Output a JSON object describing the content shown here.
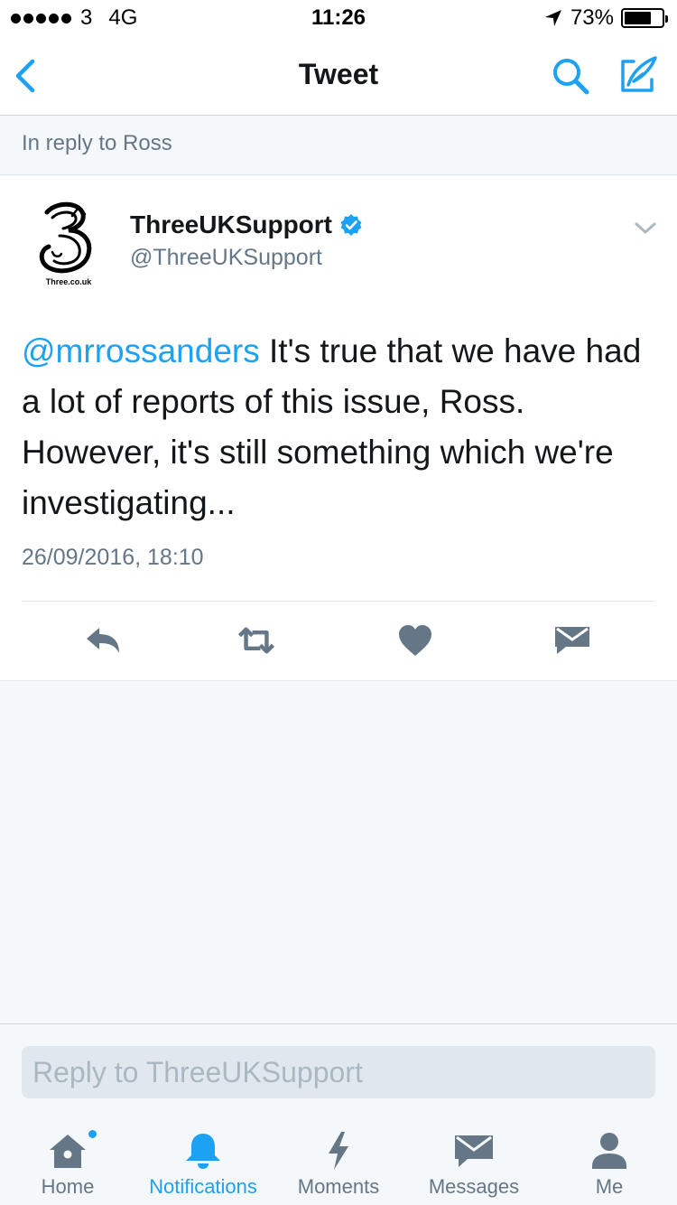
{
  "status_bar": {
    "carrier": "3",
    "network": "4G",
    "time": "11:26",
    "battery": "73%",
    "battery_level": 0.73
  },
  "nav": {
    "title": "Tweet"
  },
  "reply_context": "In reply to Ross",
  "tweet": {
    "avatar_text": "Three.co.uk",
    "author_name": "ThreeUKSupport",
    "author_handle": "@ThreeUKSupport",
    "mention": "@mrrossanders",
    "body": " It's true that we have had a lot of reports of this issue, Ross. However, it's still something which we're investigating...",
    "timestamp": "26/09/2016, 18:10"
  },
  "composer": {
    "placeholder": "Reply to ThreeUKSupport"
  },
  "tabs": [
    {
      "label": "Home",
      "icon": "home-icon"
    },
    {
      "label": "Notifications",
      "icon": "bell-icon"
    },
    {
      "label": "Moments",
      "icon": "lightning-icon"
    },
    {
      "label": "Messages",
      "icon": "envelope-icon"
    },
    {
      "label": "Me",
      "icon": "person-icon"
    }
  ],
  "colors": {
    "accent": "#1da1f2",
    "icon_gray": "#657786",
    "background": "#f5f8fa"
  }
}
